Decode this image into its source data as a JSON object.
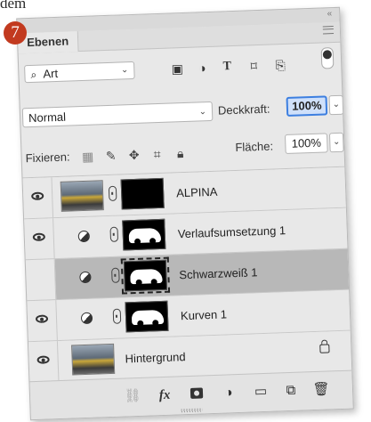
{
  "top_word": "dem",
  "step_badge": "7",
  "panel": {
    "tab": "Ebenen",
    "filter_label": "Art",
    "blend_mode": "Normal",
    "opacity_label": "Deckkraft:",
    "opacity_value": "100%",
    "lock_label": "Fixieren:",
    "fill_label": "Fläche:",
    "fill_value": "100%"
  },
  "layers": [
    {
      "name": "ALPINA",
      "type": "photo-with-mask",
      "mask": "black",
      "selected": false
    },
    {
      "name": "Verlaufsumsetzung 1",
      "type": "adjustment",
      "mask": "car",
      "selected": false
    },
    {
      "name": "Schwarzweiß 1",
      "type": "adjustment",
      "mask": "car",
      "selected": true
    },
    {
      "name": "Kurven 1",
      "type": "adjustment",
      "mask": "car",
      "selected": false
    },
    {
      "name": "Hintergrund",
      "type": "background",
      "locked": true,
      "selected": false
    }
  ],
  "colors": {
    "badge": "#c23a1f",
    "selected_row": "#b8b8b8",
    "focus_border": "#3d7fe0"
  }
}
